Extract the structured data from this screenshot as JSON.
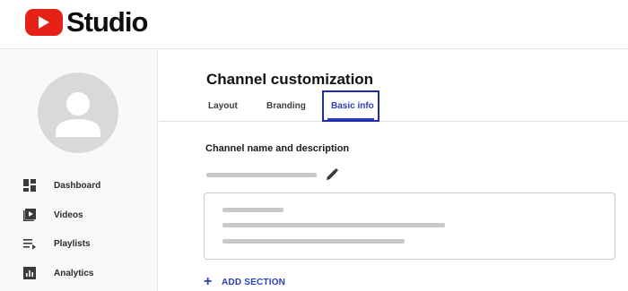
{
  "app": {
    "logo_text": "Studio"
  },
  "sidebar": {
    "items": [
      {
        "label": "Dashboard",
        "icon": "dashboard-icon"
      },
      {
        "label": "Videos",
        "icon": "videos-icon"
      },
      {
        "label": "Playlists",
        "icon": "playlists-icon"
      },
      {
        "label": "Analytics",
        "icon": "analytics-icon"
      }
    ]
  },
  "main": {
    "title": "Channel customization",
    "tabs": [
      {
        "label": "Layout"
      },
      {
        "label": "Branding"
      },
      {
        "label": "Basic info",
        "active": true
      }
    ],
    "section_title": "Channel name and description",
    "add_section_label": "ADD SECTION"
  },
  "colors": {
    "brand_red": "#e62117",
    "accent_blue": "#2a3fb8",
    "highlight_border": "#1f2ab1"
  }
}
